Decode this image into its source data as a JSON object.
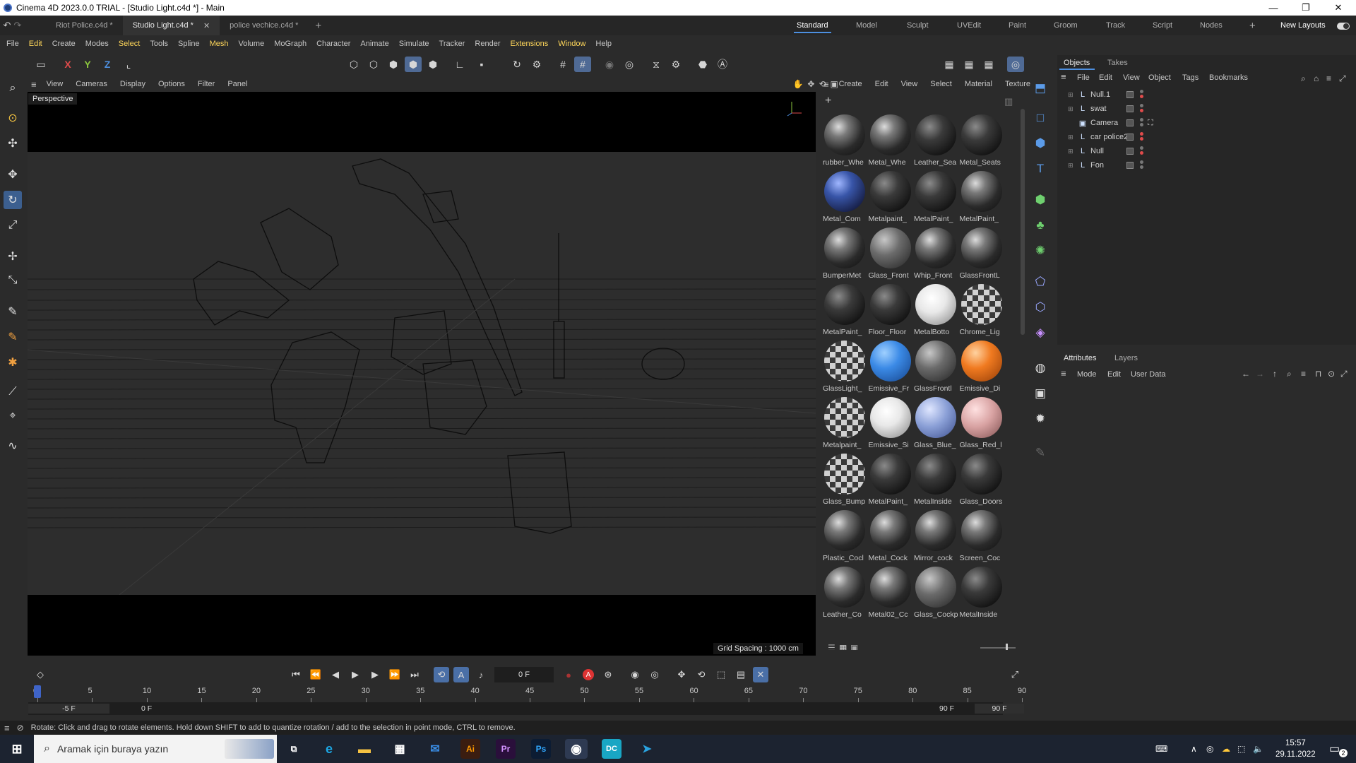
{
  "window": {
    "title": "Cinema 4D 2023.0.0 TRIAL - [Studio Light.c4d *] - Main",
    "minimize_glyph": "—",
    "restore_glyph": "❐",
    "close_glyph": "✕"
  },
  "file_tabs": [
    {
      "label": "Riot Police.c4d *",
      "active": false
    },
    {
      "label": "Studio Light.c4d *",
      "active": true,
      "close_glyph": "✕"
    },
    {
      "label": "police vechice.c4d *",
      "active": false
    }
  ],
  "add_tab_glyph": "+",
  "layouts": [
    {
      "label": "Standard",
      "active": true
    },
    {
      "label": "Model"
    },
    {
      "label": "Sculpt"
    },
    {
      "label": "UVEdit"
    },
    {
      "label": "Paint"
    },
    {
      "label": "Groom"
    },
    {
      "label": "Track"
    },
    {
      "label": "Script"
    },
    {
      "label": "Nodes"
    }
  ],
  "layout_add_glyph": "+",
  "new_layouts_label": "New Layouts",
  "main_menu": [
    "File",
    "Edit",
    "Create",
    "Modes",
    "Select",
    "Tools",
    "Spline",
    "Mesh",
    "Volume",
    "MoGraph",
    "Character",
    "Animate",
    "Simulate",
    "Tracker",
    "Render",
    "Extensions",
    "Window",
    "Help"
  ],
  "highlighted_menus": [
    "Edit",
    "Select",
    "Mesh",
    "Extensions",
    "Window"
  ],
  "toolbar": {
    "axis_x": "X",
    "axis_y": "Y",
    "axis_z": "Z"
  },
  "viewport_menu": [
    "View",
    "Cameras",
    "Display",
    "Options",
    "Filter",
    "Panel"
  ],
  "viewport_label": "Perspective",
  "grid_spacing": "Grid Spacing : 1000 cm",
  "material_menu": [
    "Create",
    "Edit",
    "View",
    "Select",
    "Material",
    "Texture"
  ],
  "materials": [
    {
      "name": "rubber_Whe",
      "kind": "tex"
    },
    {
      "name": "Metal_Whe",
      "kind": "tex"
    },
    {
      "name": "Leather_Sea",
      "kind": "dark"
    },
    {
      "name": "Metal_Seats",
      "kind": "dark"
    },
    {
      "name": "Metal_Com",
      "kind": "blue"
    },
    {
      "name": "Metalpaint_",
      "kind": "dark"
    },
    {
      "name": "MetalPaint_",
      "kind": "dark"
    },
    {
      "name": "MetalPaint_",
      "kind": "tex"
    },
    {
      "name": "BumperMet",
      "kind": "tex"
    },
    {
      "name": "Glass_Front",
      "kind": "glass"
    },
    {
      "name": "Whip_Front",
      "kind": "tex"
    },
    {
      "name": "GlassFrontL",
      "kind": "tex"
    },
    {
      "name": "MetalPaint_",
      "kind": "dark"
    },
    {
      "name": "Floor_Floor",
      "kind": "dark"
    },
    {
      "name": "MetalBotto",
      "kind": "white"
    },
    {
      "name": "Chrome_Lig",
      "kind": "checker"
    },
    {
      "name": "GlassLight_",
      "kind": "checker"
    },
    {
      "name": "Emissive_Fr",
      "kind": "bluesolid"
    },
    {
      "name": "GlassFrontl",
      "kind": "glass"
    },
    {
      "name": "Emissive_Di",
      "kind": "orange"
    },
    {
      "name": "Metalpaint_",
      "kind": "checker"
    },
    {
      "name": "Emissive_Si",
      "kind": "white"
    },
    {
      "name": "Glass_Blue_",
      "kind": "glassblue"
    },
    {
      "name": "Glass_Red_l",
      "kind": "glassred"
    },
    {
      "name": "Glass_Bump",
      "kind": "checker"
    },
    {
      "name": "MetalPaint_",
      "kind": "dark"
    },
    {
      "name": "MetalInside",
      "kind": "dark"
    },
    {
      "name": "Glass_Doors",
      "kind": "dark"
    },
    {
      "name": "Plastic_Cocl",
      "kind": "tex"
    },
    {
      "name": "Metal_Cock",
      "kind": "tex"
    },
    {
      "name": "Mirror_cock",
      "kind": "tex"
    },
    {
      "name": "Screen_Coc",
      "kind": "tex"
    },
    {
      "name": "Leather_Co",
      "kind": "tex"
    },
    {
      "name": "Metal02_Cc",
      "kind": "tex"
    },
    {
      "name": "Glass_Cockp",
      "kind": "glass"
    },
    {
      "name": "MetalInside",
      "kind": "dark"
    }
  ],
  "objects_tabs": [
    "Objects",
    "Takes"
  ],
  "objects_menu": [
    "File",
    "Edit",
    "View",
    "Object",
    "Tags",
    "Bookmarks"
  ],
  "objects": [
    {
      "name": "Null.1",
      "icon": "null-icon",
      "glyph": "L"
    },
    {
      "name": "swat",
      "icon": "null-icon",
      "glyph": "L"
    },
    {
      "name": "Camera",
      "icon": "camera-icon",
      "glyph": "▣"
    },
    {
      "name": "car police2",
      "icon": "null-icon",
      "glyph": "L"
    },
    {
      "name": "Null",
      "icon": "null-icon",
      "glyph": "L"
    },
    {
      "name": "Fon",
      "icon": "null-icon",
      "glyph": "L"
    }
  ],
  "attributes_tabs": [
    "Attributes",
    "Layers"
  ],
  "attributes_menu": [
    "Mode",
    "Edit",
    "User Data"
  ],
  "timeline": {
    "current_frame": "0 F",
    "ruler_labels": [
      "0",
      "5",
      "10",
      "15",
      "20",
      "25",
      "30",
      "35",
      "40",
      "45",
      "50",
      "55",
      "60",
      "65",
      "70",
      "75",
      "80",
      "85",
      "90"
    ],
    "range_start": "-5 F",
    "range_min": "0 F",
    "range_max": "90 F",
    "range_end": "90 F"
  },
  "status_text": "Rotate: Click and drag to rotate elements. Hold down SHIFT to add to quantize rotation / add to the selection in point mode, CTRL to remove.",
  "taskbar": {
    "search_placeholder": "Aramak için buraya yazın",
    "time": "15:57",
    "date": "29.11.2022",
    "notification_count": "2"
  },
  "colors": {
    "accent": "#4d8fe0",
    "menu_highlight": "#ffd75a",
    "panel_bg": "#2b2b2b",
    "viewport_bg": "#2d2d2d"
  }
}
